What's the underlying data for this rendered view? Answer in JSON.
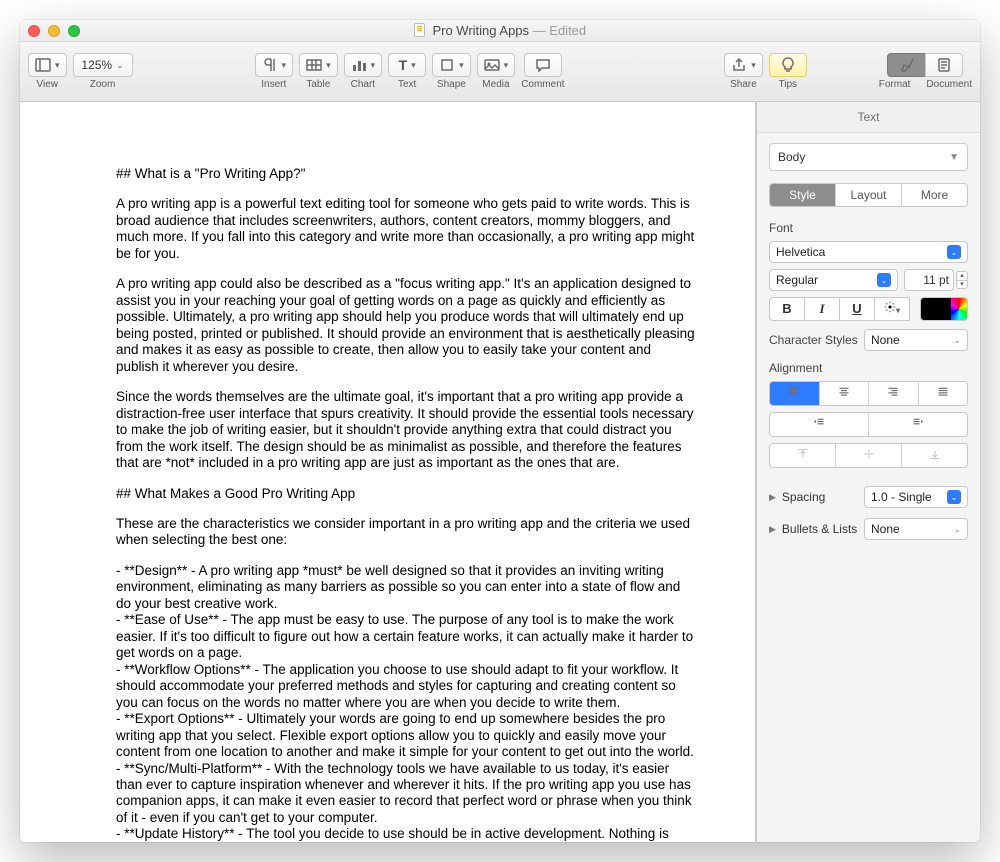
{
  "window": {
    "title": "Pro Writing Apps",
    "status": "— Edited"
  },
  "toolbar": {
    "view": "View",
    "zoom_label": "Zoom",
    "zoom_value": "125%",
    "insert": "Insert",
    "table": "Table",
    "chart": "Chart",
    "text": "Text",
    "shape": "Shape",
    "media": "Media",
    "comment": "Comment",
    "share": "Share",
    "tips": "Tips",
    "format": "Format",
    "document": "Document"
  },
  "inspector": {
    "title": "Text",
    "paragraph_style": "Body",
    "tabs": {
      "style": "Style",
      "layout": "Layout",
      "more": "More"
    },
    "font_label": "Font",
    "font_family": "Helvetica",
    "font_style": "Regular",
    "font_size": "11 pt",
    "char_styles_label": "Character Styles",
    "char_styles_value": "None",
    "alignment_label": "Alignment",
    "spacing_label": "Spacing",
    "spacing_value": "1.0 - Single",
    "bullets_label": "Bullets & Lists",
    "bullets_value": "None",
    "bold": "B",
    "italic": "I",
    "underline": "U"
  },
  "document": {
    "h1": "## What is a \"Pro Writing App?\"",
    "p1": "A pro writing app is a powerful text editing tool for someone who gets paid to write words. This is broad audience that includes screenwriters, authors, content creators, mommy bloggers, and much more. If you fall into this category and write more than occasionally, a pro writing app might be for you.",
    "p2": "A pro writing app could also be described as a \"focus writing app.\" It's an application designed to assist you in your reaching your goal of getting words on a page as quickly and efficiently as possible. Ultimately, a pro writing app should help you produce words that will ultimately end up being posted, printed or published. It should provide an environment that is aesthetically pleasing and makes it as easy as possible to create, then allow you to easily take your content and publish it wherever you desire.",
    "p3": "Since the words themselves are the ultimate goal, it's important that a pro writing app provide a distraction-free user interface that spurs creativity. It should provide the essential tools necessary to make the job of writing easier, but it shouldn't provide anything extra that could distract you from the work itself. The design should be as minimalist as possible, and therefore the features that are *not* included in a pro writing app are just as important as the ones that are.",
    "h2": "## What Makes a Good Pro Writing App",
    "p4": "These are the characteristics we consider important in a pro writing app and the criteria we used when selecting the best one:",
    "b1": "- **Design** - A pro writing app *must* be well designed so that it provides an inviting writing environment, eliminating as many barriers as possible so you can enter into a state of flow and do your best creative work.",
    "b2": "- **Ease of Use** - The app must be easy to use. The purpose of any tool is to make the work easier. If it's too difficult to figure out how a certain feature works, it can actually make it harder to get words on a page.",
    "b3": "- **Workflow Options** - The application you choose to use should adapt to fit your workflow. It should accommodate your preferred methods and styles for capturing and creating content so you can focus on the words no matter where you are when you decide to write them.",
    "b4": "- **Export Options** - Ultimately your words are going to end up somewhere besides the pro writing app that you select. Flexible export options allow you to quickly and easily move your content from one location to another and make it simple for your content to get out into the world.",
    "b5": "- **Sync/Multi-Platform** - With the technology tools we have available to us today, it's easier than ever to capture inspiration whenever and wherever it hits. If the pro writing app you use has companion apps, it can make it even easier to record that perfect word or phrase when you think of it - even if you can't get to your computer.",
    "b6": "- **Update History** - The tool you decide to use should be in active development. Nothing is"
  }
}
